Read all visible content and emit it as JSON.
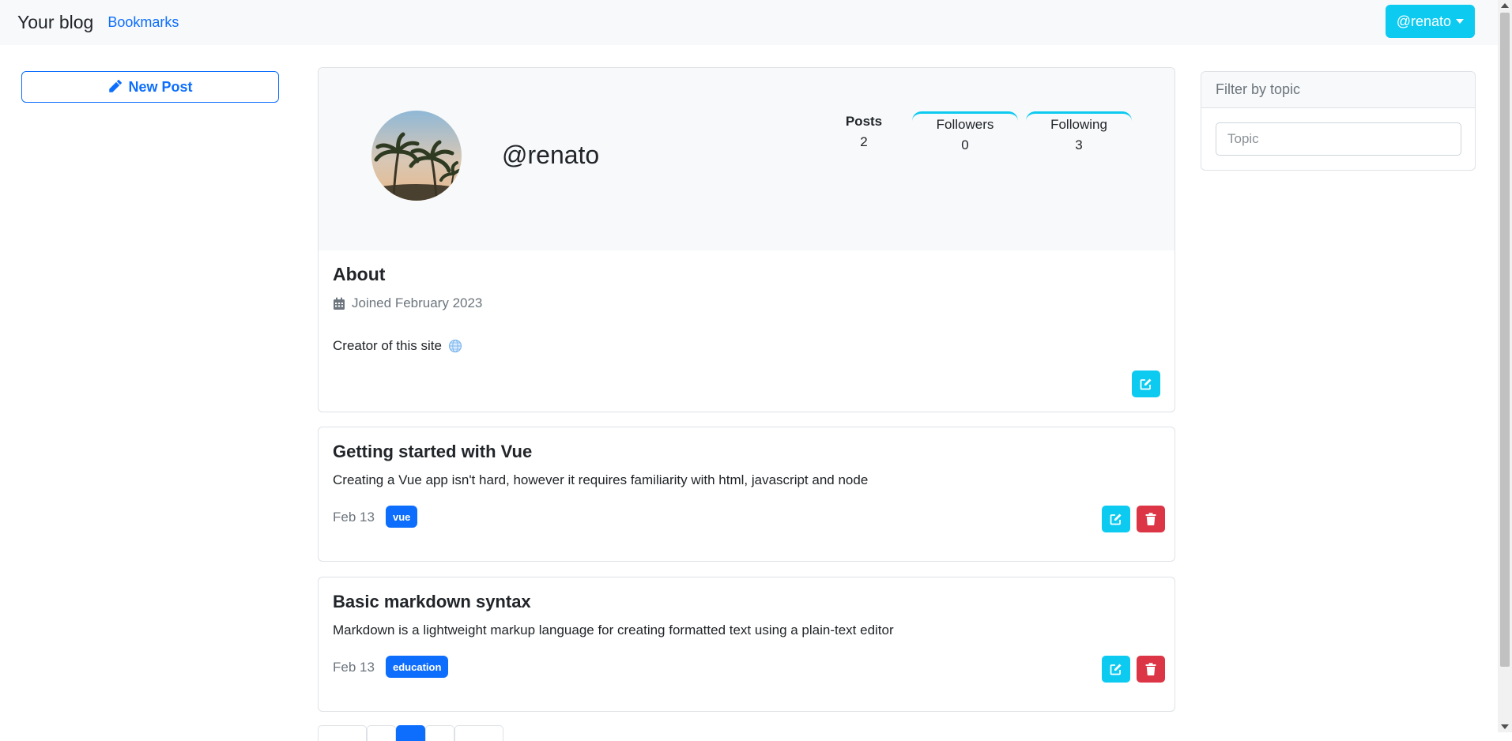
{
  "navbar": {
    "brand": "Your blog",
    "bookmarks": "Bookmarks",
    "user_button": "@renato"
  },
  "sidebar": {
    "new_post": "New Post"
  },
  "profile": {
    "username": "@renato",
    "stats": {
      "posts_label": "Posts",
      "posts_value": "2",
      "followers_label": "Followers",
      "followers_value": "0",
      "following_label": "Following",
      "following_value": "3"
    },
    "about_title": "About",
    "joined": "Joined February 2023",
    "bio": "Creator of this site"
  },
  "posts": [
    {
      "title": "Getting started with Vue",
      "description": "Creating a Vue app isn't hard, however it requires familiarity with html, javascript and node",
      "date": "Feb 13",
      "tag": "vue"
    },
    {
      "title": "Basic markdown syntax",
      "description": "Markdown is a lightweight markup language for creating formatted text using a plain-text editor",
      "date": "Feb 13",
      "tag": "education"
    }
  ],
  "filter": {
    "title": "Filter by topic",
    "placeholder": "Topic"
  },
  "colors": {
    "primary": "#0d6efd",
    "info": "#0dcaf0",
    "danger": "#dc3545"
  }
}
